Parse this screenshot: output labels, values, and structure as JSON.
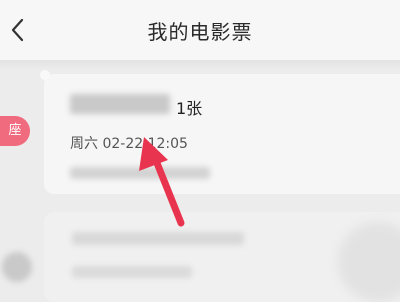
{
  "header": {
    "title": "我的电影票",
    "back_icon": "chevron-left-icon"
  },
  "ticket": {
    "badge": "座",
    "movie_name": "",
    "count": "1张",
    "showtime": "周六 02-22 12:05",
    "cinema_line": ""
  },
  "second_ticket": {
    "line1": "",
    "line2": ""
  },
  "colors": {
    "badge": "#f06b7e",
    "arrow": "#e8344e"
  }
}
